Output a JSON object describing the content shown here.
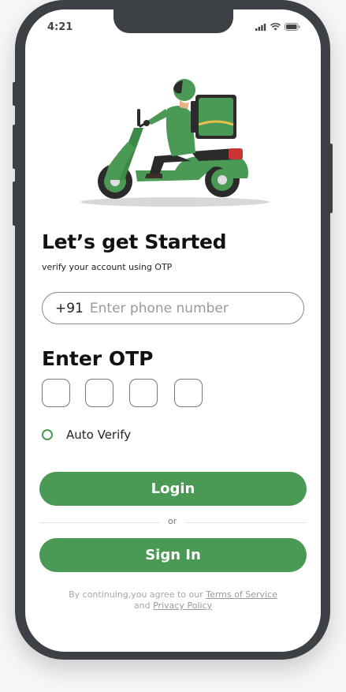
{
  "status_bar": {
    "time": "4:21"
  },
  "header": {
    "title": "Let’s get Started",
    "subtitle": "verify your account using OTP"
  },
  "phone": {
    "country_code": "+91",
    "placeholder": "Enter phone number",
    "value": ""
  },
  "otp": {
    "title": "Enter OTP",
    "digits": [
      "",
      "",
      "",
      ""
    ]
  },
  "auto_verify": {
    "label": "Auto Verify",
    "checked": false
  },
  "actions": {
    "login_label": "Login",
    "or_label": "or",
    "signin_label": "Sign In"
  },
  "legal": {
    "prefix": "By continuing,you agree to our ",
    "terms": "Terms of Service",
    "and": "and ",
    "privacy": "Privacy Policy"
  },
  "colors": {
    "accent": "#4a9a55",
    "frame": "#3d4044"
  },
  "icons": {
    "signal": "signal-icon",
    "wifi": "wifi-icon",
    "battery": "battery-icon",
    "illustration": "delivery-scooter-illustration"
  }
}
